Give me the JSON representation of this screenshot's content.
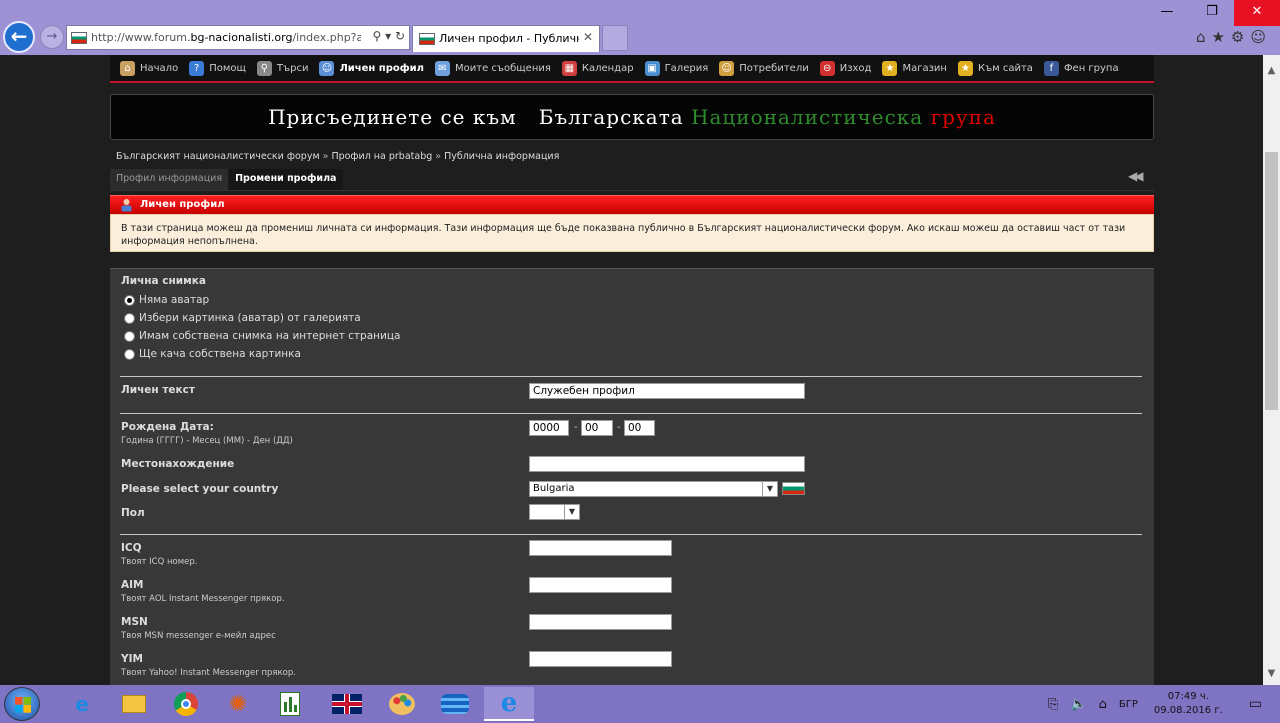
{
  "browser": {
    "url_prefix": "http://www.forum.",
    "url_domain": "bg-nacionalisti.org",
    "url_rest": "/index.php?acti",
    "tab_title": "Личен профил - Публичн...",
    "tab_close": "✕",
    "min": "—",
    "max": "❐",
    "close": "✕",
    "back": "←",
    "forward": "→",
    "addr_icons": "⚲ ▾ ↻",
    "chrome_icons": "⌂★⚙☺"
  },
  "menu": [
    {
      "label": "Начало",
      "icon": "home-icon",
      "color": "#c8a060",
      "glyph": "⌂"
    },
    {
      "label": "Помощ",
      "icon": "help-icon",
      "color": "#3a7bd5",
      "glyph": "?"
    },
    {
      "label": "Търси",
      "icon": "search-icon",
      "color": "#888",
      "glyph": "⚲"
    },
    {
      "label": "Личен профил",
      "icon": "profile-icon",
      "color": "#5b8fd6",
      "glyph": "☺"
    },
    {
      "label": "Моите съобщения",
      "icon": "mail-icon",
      "color": "#6ea0dd",
      "glyph": "✉"
    },
    {
      "label": "Календар",
      "icon": "calendar-icon",
      "color": "#d04040",
      "glyph": "▦"
    },
    {
      "label": "Галерия",
      "icon": "gallery-icon",
      "color": "#4a8fd0",
      "glyph": "▣"
    },
    {
      "label": "Потребители",
      "icon": "users-icon",
      "color": "#d0a040",
      "glyph": "☺"
    },
    {
      "label": "Изход",
      "icon": "logout-icon",
      "color": "#d03030",
      "glyph": "⊖"
    },
    {
      "label": "Магазин",
      "icon": "shop-star-icon",
      "color": "#e0b020",
      "glyph": "★"
    },
    {
      "label": "Към сайта",
      "icon": "site-star-icon",
      "color": "#e0b020",
      "glyph": "★"
    },
    {
      "label": "Фен група",
      "icon": "facebook-icon",
      "color": "#3b5998",
      "glyph": "f"
    }
  ],
  "banner": {
    "part1": "Присъединете се към",
    "part2": "Българската",
    "part3": "Националистическа",
    "part4": "група"
  },
  "breadcrumb": {
    "item1": "Българският националистически форум",
    "item2": "Профил на prbatabg",
    "item3": "Публична информация",
    "sep": "»"
  },
  "subtabs": {
    "profile_info": "Профил информация",
    "edit_profile": "Промени профила"
  },
  "section": {
    "title": "Личен профил",
    "notice": "В тази страница можеш да промениш личната си информация. Тази информация ще бъде показвана публично в Българският националистически форум. Ако искаш можеш да оставиш част от тази информация непопълнена."
  },
  "form": {
    "avatar_label": "Лична снимка",
    "avatar_options": [
      "Няма аватар",
      "Избери картинка (аватар) от галерията",
      "Имам собствена снимка на интернет страница",
      "Ще кача собствена картинка"
    ],
    "personal_text_label": "Личен текст",
    "personal_text_value": "Служебен профил",
    "birthdate_label": "Рождена Дата:",
    "birthdate_hint": "Година (ГГГГ) - Месец (ММ) - Ден (ДД)",
    "birth_year": "0000",
    "birth_month": "00",
    "birth_day": "00",
    "date_sep": "-",
    "location_label": "Местонахождение",
    "location_value": "",
    "country_label": "Please select your country",
    "country_value": "Bulgaria",
    "gender_label": "Пол",
    "gender_value": "",
    "icq_label": "ICQ",
    "icq_hint": "Твоят ICQ номер.",
    "aim_label": "AIM",
    "aim_hint": "Твоят AOL Instant Messenger прякор.",
    "msn_label": "MSN",
    "msn_hint": "Твоя MSN messenger е-мейл адрес",
    "yim_label": "YIM",
    "yim_hint": "Твоят Yahoo! Instant Messenger прякор."
  },
  "taskbar": {
    "apps": [
      "edge-icon",
      "explorer-icon",
      "chrome-icon",
      "paint-icon",
      "charts-icon",
      "uk-flag-icon",
      "palette-icon",
      "stack-icon",
      "ie-icon"
    ],
    "lang": "БГР",
    "time": "07:49 ч.",
    "date": "09.08.2016 г."
  }
}
